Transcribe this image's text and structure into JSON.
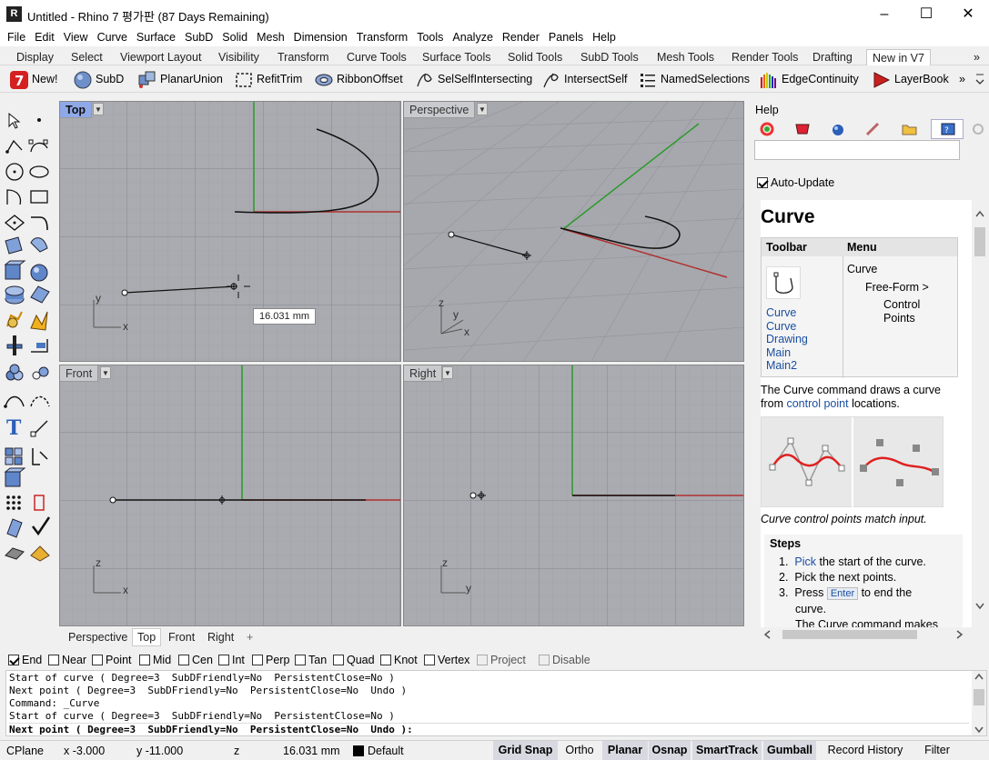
{
  "window": {
    "title": "Untitled - Rhino 7 평가판 (87 Days Remaining)",
    "minimize": "–",
    "maximize": "☐",
    "close": "✕"
  },
  "menu": [
    "File",
    "Edit",
    "View",
    "Curve",
    "Surface",
    "SubD",
    "Solid",
    "Mesh",
    "Dimension",
    "Transform",
    "Tools",
    "Analyze",
    "Render",
    "Panels",
    "Help"
  ],
  "tabs": [
    "Display",
    "Select",
    "Viewport Layout",
    "Visibility",
    "Transform",
    "Curve Tools",
    "Surface Tools",
    "Solid Tools",
    "SubD Tools",
    "Mesh Tools",
    "Render Tools",
    "Drafting",
    "New in V7"
  ],
  "tabs_more": "»",
  "toolbar": [
    "New!",
    "SubD",
    "PlanarUnion",
    "RefitTrim",
    "RibbonOffset",
    "SelSelfIntersecting",
    "IntersectSelf",
    "NamedSelections",
    "EdgeContinuity",
    "LayerBook"
  ],
  "toolbar_more": "»",
  "viewports": {
    "top": {
      "label": "Top",
      "tooltip": "16.031 mm"
    },
    "perspective": {
      "label": "Perspective"
    },
    "front": {
      "label": "Front"
    },
    "right": {
      "label": "Right"
    }
  },
  "axes": {
    "x": "x",
    "y": "y",
    "z": "z"
  },
  "viewtabs": [
    "Perspective",
    "Top",
    "Front",
    "Right"
  ],
  "viewtabs_add": "+",
  "osnaps": [
    {
      "label": "End",
      "checked": true
    },
    {
      "label": "Near",
      "checked": false
    },
    {
      "label": "Point",
      "checked": false
    },
    {
      "label": "Mid",
      "checked": false
    },
    {
      "label": "Cen",
      "checked": false
    },
    {
      "label": "Int",
      "checked": false
    },
    {
      "label": "Perp",
      "checked": false
    },
    {
      "label": "Tan",
      "checked": false
    },
    {
      "label": "Quad",
      "checked": false
    },
    {
      "label": "Knot",
      "checked": false
    },
    {
      "label": "Vertex",
      "checked": false
    },
    {
      "label": "Project",
      "checked": false
    },
    {
      "label": "Disable",
      "checked": false
    }
  ],
  "command_history": [
    "Start of curve ( Degree=3  SubDFriendly=No  PersistentClose=No )",
    "Next point ( Degree=3  SubDFriendly=No  PersistentClose=No  Undo )",
    "Command: _Curve",
    "Start of curve ( Degree=3  SubDFriendly=No  PersistentClose=No )"
  ],
  "command_prompt": "Next point ( Degree=3  SubDFriendly=No  PersistentClose=No  Undo ):",
  "status": {
    "cplane": "CPlane",
    "x": "x -3.000",
    "y": "y -11.000",
    "z": "z",
    "distance": "16.031 mm",
    "layer": "Default",
    "buttons": [
      "Grid Snap",
      "Ortho",
      "Planar",
      "Osnap",
      "SmartTrack",
      "Gumball",
      "Record History",
      "Filter"
    ]
  },
  "help": {
    "panel_title": "Help",
    "auto_update": "Auto-Update",
    "doc_title": "Curve",
    "col_toolbar": "Toolbar",
    "col_menu": "Menu",
    "menu_path": [
      "Curve",
      "Free-Form >",
      "Control",
      "Points"
    ],
    "toolbar_links": [
      "Curve",
      "Curve",
      "Drawing",
      "Main",
      "Main2"
    ],
    "desc_pre": "The Curve command draws a curve from ",
    "desc_link": "control point",
    "desc_post": " locations.",
    "caption": "Curve control points match input.",
    "steps_title": "Steps",
    "step1_link": "Pick",
    "step1_rest": " the start of the curve.",
    "step2": "Pick the next points.",
    "step3_pre": "Press ",
    "step3_key": "Enter",
    "step3_post": " to end the",
    "step3_cont": "curve.",
    "more": "The Curve command makes"
  },
  "colors": {
    "accent": "#8fa8e8",
    "x_axis": "#b03030",
    "y_axis": "#30a030",
    "link": "#1a4fa0",
    "grid_bg": "#a9abb0"
  }
}
